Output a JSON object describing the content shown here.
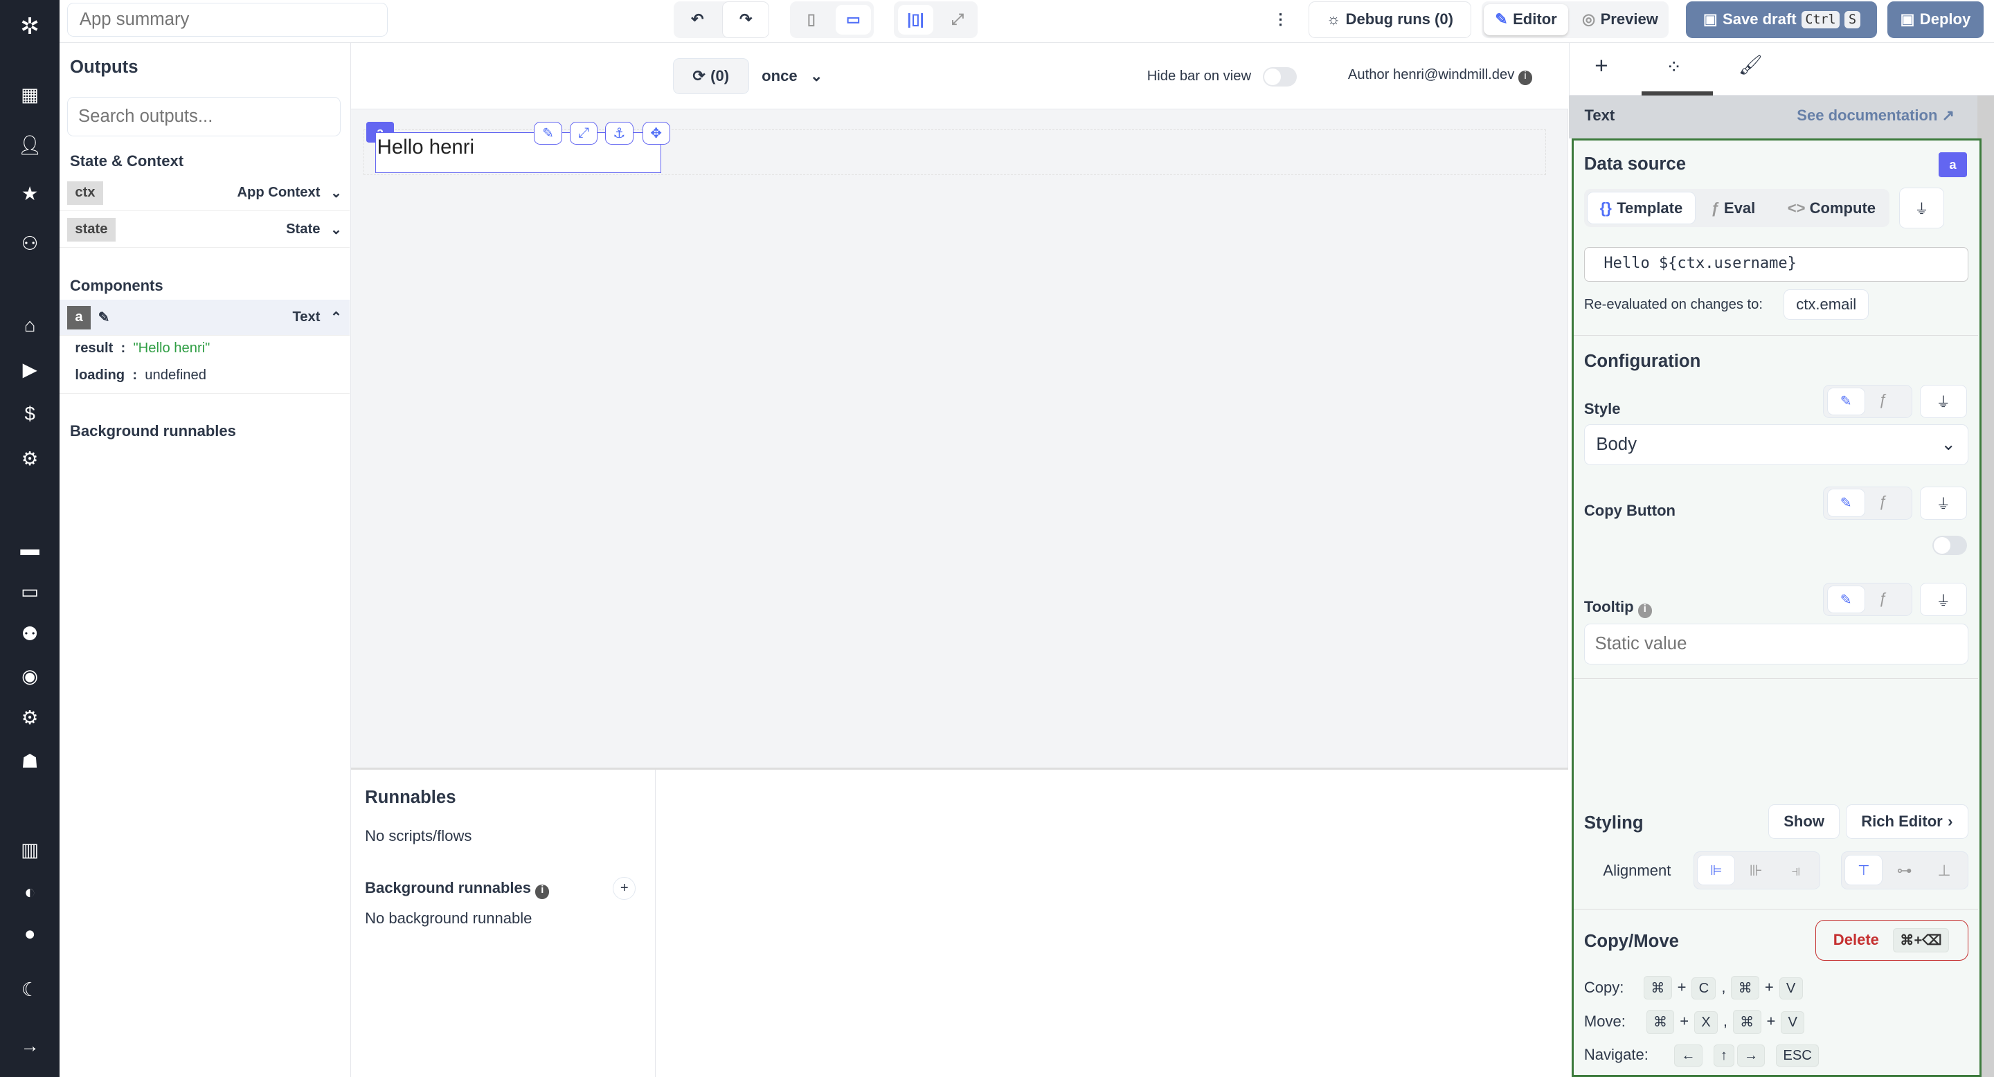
{
  "topbar": {
    "app_summary_placeholder": "App summary",
    "debug_runs": "Debug runs (0)",
    "editor": "Editor",
    "preview": "Preview",
    "save_draft": "Save draft",
    "save_kbd1": "Ctrl",
    "save_kbd2": "S",
    "deploy": "Deploy"
  },
  "canvas_bar": {
    "refresh": "(0)",
    "frequency": "once",
    "hide_bar": "Hide bar on view",
    "author": "Author henri@windmill.dev"
  },
  "canvas": {
    "component_id": "a",
    "text": "Hello henri"
  },
  "outputs": {
    "title": "Outputs",
    "search_placeholder": "Search outputs...",
    "state_context": "State & Context",
    "ctx_tag": "ctx",
    "ctx_label": "App Context",
    "state_tag": "state",
    "state_label": "State",
    "components": "Components",
    "comp_tag": "a",
    "comp_label": "Text",
    "result_key": "result",
    "result_val": "\"Hello henri\"",
    "loading_key": "loading",
    "loading_val": "undefined",
    "bg_runnables": "Background runnables"
  },
  "runnables": {
    "title": "Runnables",
    "none": "No scripts/flows",
    "bg_title": "Background runnables",
    "bg_none": "No background runnable"
  },
  "panel": {
    "component": "Text",
    "see_docs": "See documentation",
    "data_source": "Data source",
    "badge": "a",
    "tabs": [
      "Template",
      "Eval",
      "Compute"
    ],
    "template_value": "Hello ${ctx.username}",
    "reeval": "Re-evaluated on changes to:",
    "reeval_dep": "ctx.email",
    "configuration": "Configuration",
    "style": "Style",
    "style_value": "Body",
    "copy_button": "Copy Button",
    "copy_button_on": false,
    "tooltip": "Tooltip",
    "tooltip_placeholder": "Static value",
    "styling": "Styling",
    "show": "Show",
    "rich_editor": "Rich Editor",
    "alignment": "Alignment",
    "copy_move": "Copy/Move",
    "delete": "Delete",
    "delete_kbd": "⌘+⌫",
    "copy": "Copy:",
    "move": "Move:",
    "navigate": "Navigate:"
  },
  "colors": {
    "nav_bg": "#1e232e",
    "primary": "#6780a8",
    "accent": "#4f6ef7",
    "panel_border": "#3c7a3c",
    "danger": "#c53030"
  }
}
